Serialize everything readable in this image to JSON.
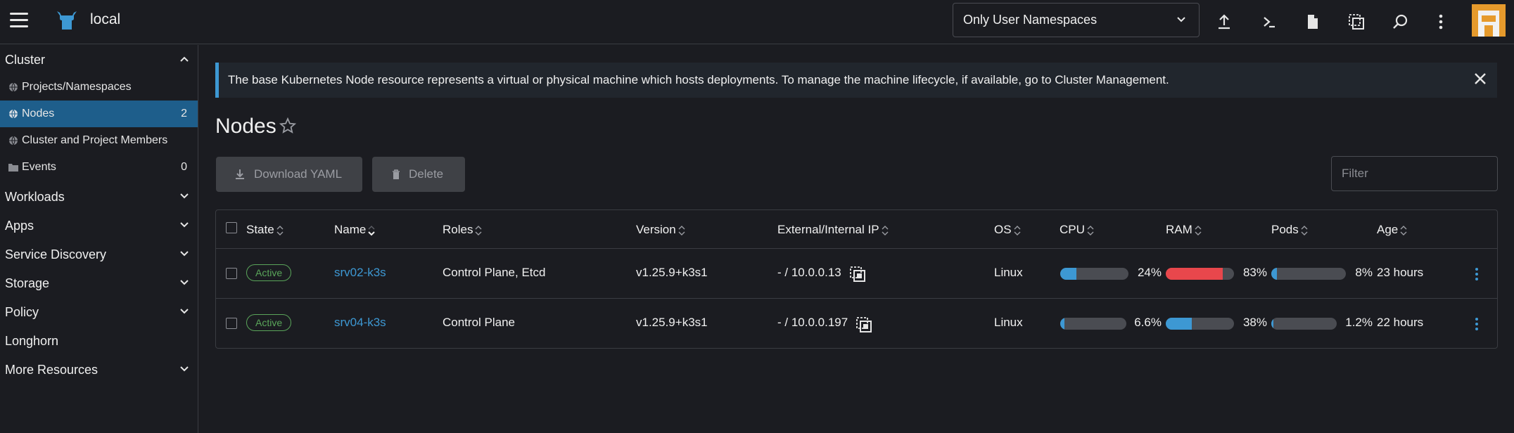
{
  "header": {
    "cluster_name": "local",
    "namespace_selector": "Only User Namespaces"
  },
  "sidebar": {
    "groups": [
      {
        "label": "Cluster"
      },
      {
        "label": "Workloads"
      },
      {
        "label": "Apps"
      },
      {
        "label": "Service Discovery"
      },
      {
        "label": "Storage"
      },
      {
        "label": "Policy"
      },
      {
        "label": "Longhorn"
      },
      {
        "label": "More Resources"
      }
    ],
    "items": [
      {
        "label": "Projects/Namespaces",
        "count": ""
      },
      {
        "label": "Nodes",
        "count": "2"
      },
      {
        "label": "Cluster and Project Members",
        "count": ""
      },
      {
        "label": "Events",
        "count": "0"
      }
    ]
  },
  "banner": {
    "text": "The base Kubernetes Node resource represents a virtual or physical machine which hosts deployments. To manage the machine lifecycle, if available, go to Cluster Management."
  },
  "page": {
    "title": "Nodes",
    "download_label": "Download YAML",
    "delete_label": "Delete",
    "filter_placeholder": "Filter"
  },
  "table": {
    "columns": [
      "State",
      "Name",
      "Roles",
      "Version",
      "External/Internal IP",
      "OS",
      "CPU",
      "RAM",
      "Pods",
      "Age"
    ],
    "rows": [
      {
        "state": "Active",
        "name": "srv02-k3s",
        "roles": "Control Plane, Etcd",
        "version": "v1.25.9+k3s1",
        "ip": "- / 10.0.0.13",
        "os": "Linux",
        "cpu": "24%",
        "cpu_value": 24,
        "ram": "83%",
        "ram_value": 83,
        "pods": "8%",
        "pods_value": 8,
        "age": "23 hours"
      },
      {
        "state": "Active",
        "name": "srv04-k3s",
        "roles": "Control Plane",
        "version": "v1.25.9+k3s1",
        "ip": "- / 10.0.0.197",
        "os": "Linux",
        "cpu": "6.6%",
        "cpu_value": 6.6,
        "ram": "38%",
        "ram_value": 38,
        "pods": "1.2%",
        "pods_value": 1.2,
        "age": "22 hours"
      }
    ]
  },
  "colors": {
    "accent": "#3d98d3",
    "active_nav": "#1e5e8b",
    "bar_normal": "#3d98d3",
    "bar_high": "#e8474c",
    "state_active": "#5aa55a"
  }
}
